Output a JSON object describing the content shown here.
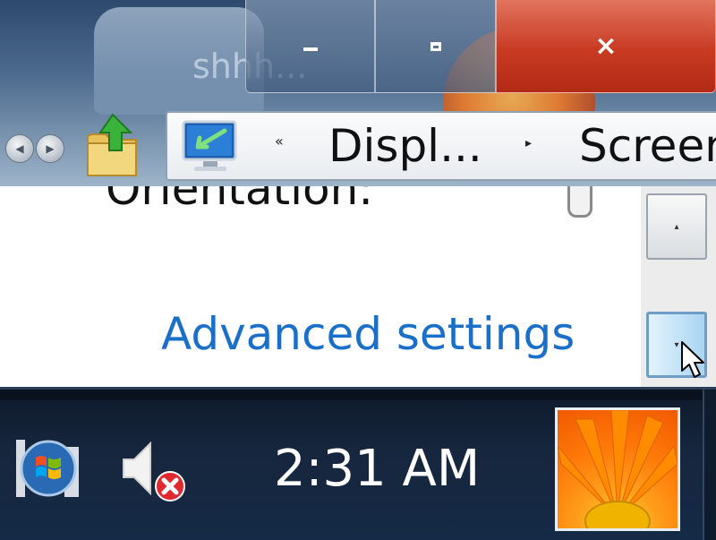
{
  "desktop": {
    "bin_overlay_text": "shhh..."
  },
  "window": {
    "minimize_icon": "minimize-icon",
    "maximize_icon": "maximize-icon",
    "close_glyph": "×"
  },
  "navbar": {
    "back_glyph": "◀",
    "forward_glyph": "▶",
    "breadcrumb": {
      "overflow_glyph": "«",
      "items": [
        {
          "label": "Displ..."
        },
        {
          "label": "Screen"
        }
      ],
      "separator_glyph": "▸"
    }
  },
  "content": {
    "orientation_label": "Orientation:",
    "advanced_link": "Advanced settings"
  },
  "scrollbar": {
    "up_glyph": "▴",
    "down_glyph": "▾"
  },
  "taskbar": {
    "clock": "2:31 AM"
  },
  "colors": {
    "link": "#1a6fc9",
    "close_button": "#c83a22",
    "taskbar": "#16263d"
  }
}
